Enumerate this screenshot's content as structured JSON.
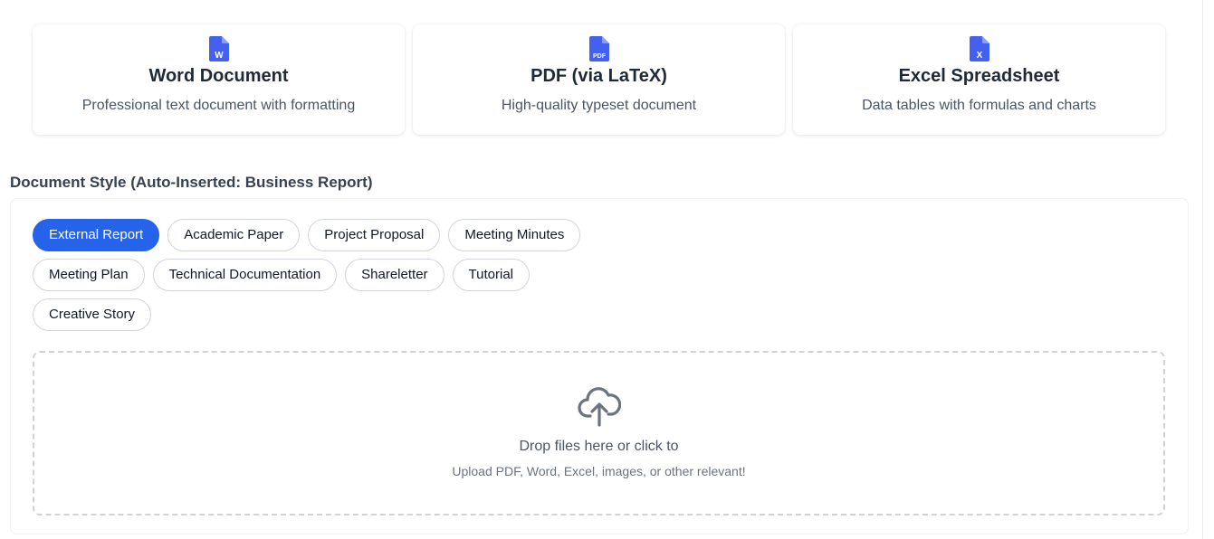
{
  "formats": [
    {
      "title": "Word Document",
      "description": "Professional text document with formatting",
      "icon": "word-file-icon",
      "icon_letter": "W",
      "color": "#4361ee"
    },
    {
      "title": "PDF (via LaTeX)",
      "description": "High-quality typeset document",
      "icon": "pdf-file-icon",
      "icon_letter": "PDF",
      "color": "#4361ee"
    },
    {
      "title": "Excel Spreadsheet",
      "description": "Data tables with formulas and charts",
      "icon": "excel-file-icon",
      "icon_letter": "X",
      "color": "#4361ee"
    }
  ],
  "style_section": {
    "label": "Document Style (Auto-Inserted: Business Report)",
    "options": [
      "External Report",
      "Academic Paper",
      "Project Proposal",
      "Meeting Minutes",
      "Meeting Plan",
      "Technical Documentation",
      "Shareletter",
      "Tutorial",
      "Creative Story"
    ],
    "selected": "External Report",
    "accent": "#2563eb"
  },
  "dropzone": {
    "title": "Drop files here or click to",
    "subtitle": "Upload PDF, Word, Excel, images, or other relevant!",
    "icon": "cloud-upload-icon"
  }
}
